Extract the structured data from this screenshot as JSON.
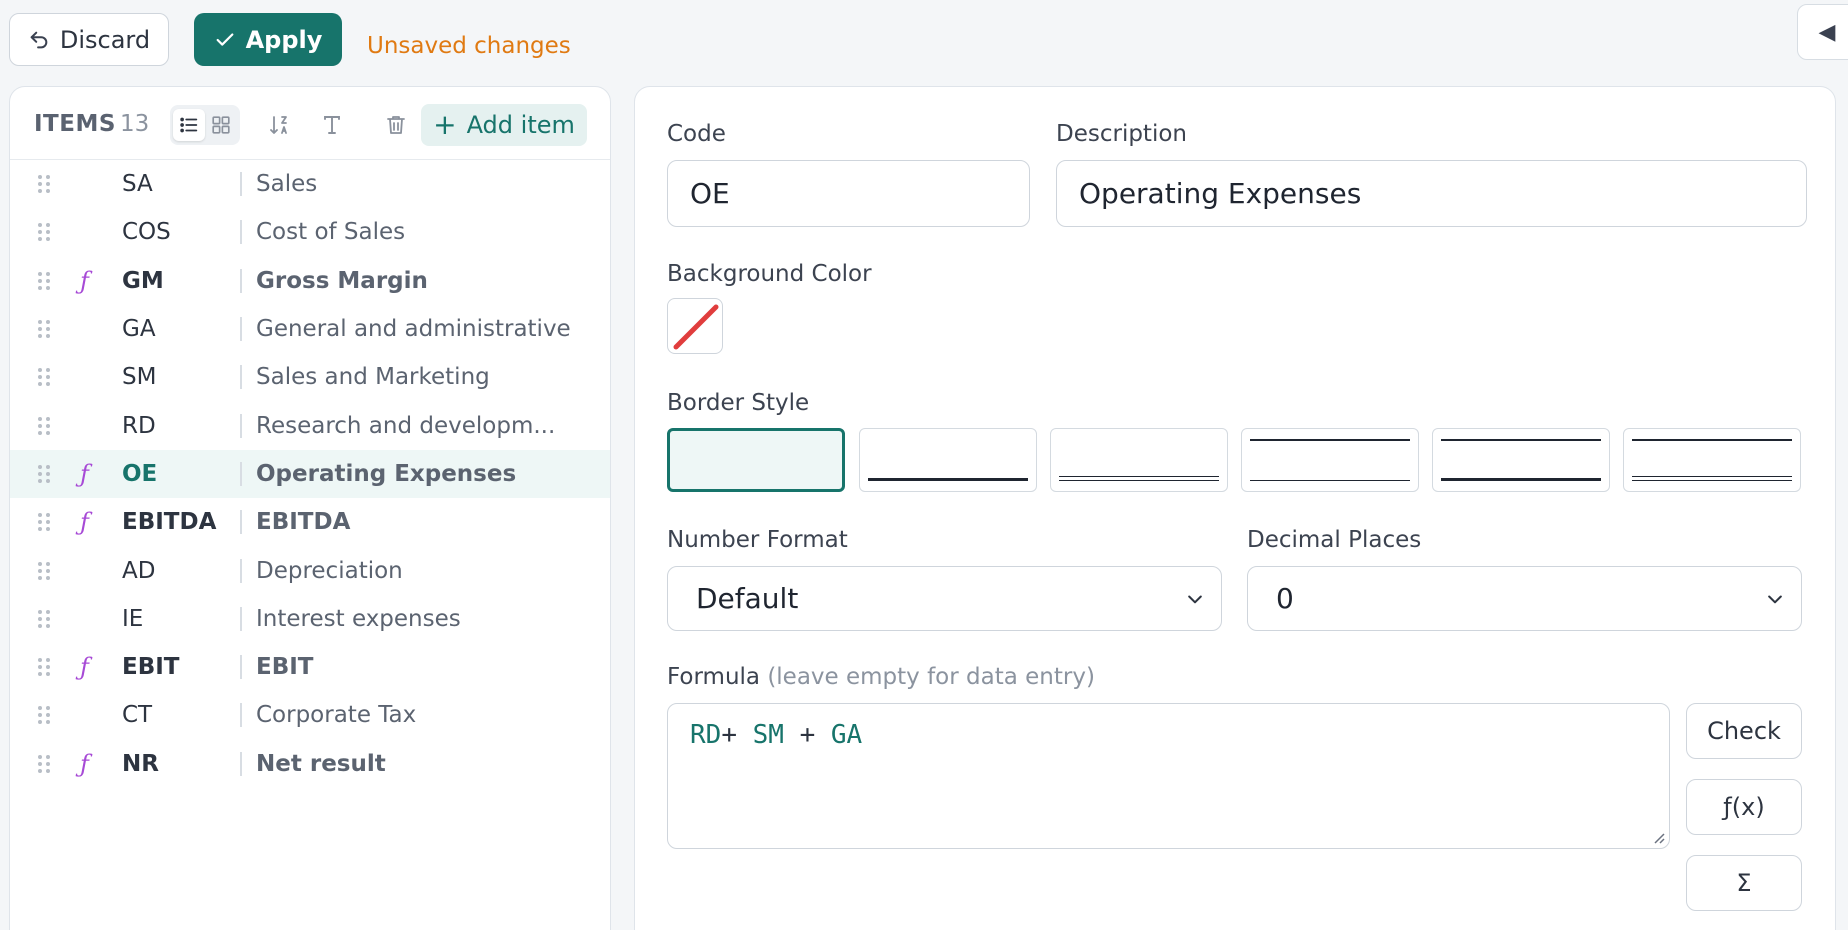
{
  "toolbar": {
    "discard_label": "Discard",
    "apply_label": "Apply",
    "status": "Unsaved changes"
  },
  "items_panel": {
    "title": "ITEMS",
    "count": "13",
    "add_label": "Add item",
    "items": [
      {
        "code": "SA",
        "description": "Sales",
        "formula": false,
        "selected": false
      },
      {
        "code": "COS",
        "description": "Cost of Sales",
        "formula": false,
        "selected": false
      },
      {
        "code": "GM",
        "description": "Gross Margin",
        "formula": true,
        "selected": false
      },
      {
        "code": "GA",
        "description": "General and administrative",
        "formula": false,
        "selected": false
      },
      {
        "code": "SM",
        "description": "Sales and Marketing",
        "formula": false,
        "selected": false
      },
      {
        "code": "RD",
        "description": "Research and developm...",
        "formula": false,
        "selected": false
      },
      {
        "code": "OE",
        "description": "Operating Expenses",
        "formula": true,
        "selected": true
      },
      {
        "code": "EBITDA",
        "description": "EBITDA",
        "formula": true,
        "selected": false
      },
      {
        "code": "AD",
        "description": "Depreciation",
        "formula": false,
        "selected": false
      },
      {
        "code": "IE",
        "description": "Interest expenses",
        "formula": false,
        "selected": false
      },
      {
        "code": "EBIT",
        "description": "EBIT",
        "formula": true,
        "selected": false
      },
      {
        "code": "CT",
        "description": "Corporate Tax",
        "formula": false,
        "selected": false
      },
      {
        "code": "NR",
        "description": "Net result",
        "formula": true,
        "selected": false
      }
    ]
  },
  "editor": {
    "code_label": "Code",
    "code_value": "OE",
    "description_label": "Description",
    "description_value": "Operating Expenses",
    "background_label": "Background Color",
    "border_label": "Border Style",
    "number_format_label": "Number Format",
    "number_format_value": "Default",
    "decimal_label": "Decimal Places",
    "decimal_value": "0",
    "formula_label": "Formula",
    "formula_hint": "(leave empty for data entry)",
    "formula_tokens": [
      "RD",
      "+",
      " SM",
      " + ",
      "GA"
    ],
    "check_label": "Check",
    "fx_label": "ƒ(x)",
    "sigma_label": "Σ"
  },
  "colors": {
    "accent": "#17746b",
    "warning": "#e07a12",
    "formula_icon": "#a74ad6"
  }
}
